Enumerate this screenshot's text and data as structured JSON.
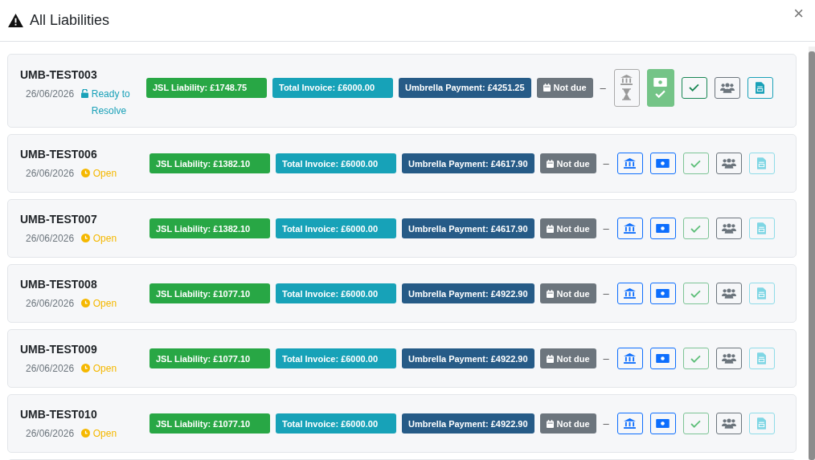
{
  "dialog": {
    "title": "All Liabilities",
    "close": "×"
  },
  "rows": [
    {
      "id": "UMB-TEST003",
      "date": "26/06/2026",
      "status": {
        "kind": "ready",
        "label": "Ready to Resolve"
      },
      "liability": "JSL Liability: £1748.75",
      "invoice": "Total Invoice: £6000.00",
      "umbrella": "Umbrella Payment: £4251.25",
      "due": "Not due",
      "separator": "–",
      "bank_pending": true,
      "payment_done": true,
      "check_confirmed": true,
      "document_enabled": true
    },
    {
      "id": "UMB-TEST006",
      "date": "26/06/2026",
      "status": {
        "kind": "open",
        "label": "Open"
      },
      "liability": "JSL Liability: £1382.10",
      "invoice": "Total Invoice: £6000.00",
      "umbrella": "Umbrella Payment: £4617.90",
      "due": "Not due",
      "separator": "–",
      "bank_pending": false,
      "payment_done": false,
      "check_confirmed": false,
      "document_enabled": false
    },
    {
      "id": "UMB-TEST007",
      "date": "26/06/2026",
      "status": {
        "kind": "open",
        "label": "Open"
      },
      "liability": "JSL Liability: £1382.10",
      "invoice": "Total Invoice: £6000.00",
      "umbrella": "Umbrella Payment: £4617.90",
      "due": "Not due",
      "separator": "–",
      "bank_pending": false,
      "payment_done": false,
      "check_confirmed": false,
      "document_enabled": false
    },
    {
      "id": "UMB-TEST008",
      "date": "26/06/2026",
      "status": {
        "kind": "open",
        "label": "Open"
      },
      "liability": "JSL Liability: £1077.10",
      "invoice": "Total Invoice: £6000.00",
      "umbrella": "Umbrella Payment: £4922.90",
      "due": "Not due",
      "separator": "–",
      "bank_pending": false,
      "payment_done": false,
      "check_confirmed": false,
      "document_enabled": false
    },
    {
      "id": "UMB-TEST009",
      "date": "26/06/2026",
      "status": {
        "kind": "open",
        "label": "Open"
      },
      "liability": "JSL Liability: £1077.10",
      "invoice": "Total Invoice: £6000.00",
      "umbrella": "Umbrella Payment: £4922.90",
      "due": "Not due",
      "separator": "–",
      "bank_pending": false,
      "payment_done": false,
      "check_confirmed": false,
      "document_enabled": false
    },
    {
      "id": "UMB-TEST010",
      "date": "26/06/2026",
      "status": {
        "kind": "open",
        "label": "Open"
      },
      "liability": "JSL Liability: £1077.10",
      "invoice": "Total Invoice: £6000.00",
      "umbrella": "Umbrella Payment: £4922.90",
      "due": "Not due",
      "separator": "–",
      "bank_pending": false,
      "payment_done": false,
      "check_confirmed": false,
      "document_enabled": false
    }
  ]
}
